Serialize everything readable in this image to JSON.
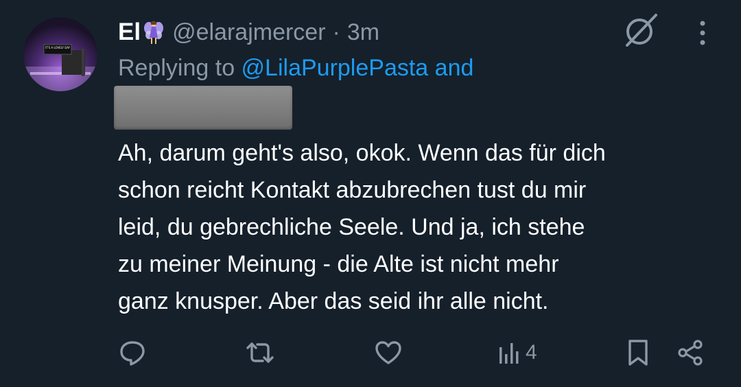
{
  "tweet": {
    "display_name": "El",
    "handle": "@elarajmercer",
    "separator": "·",
    "time": "3m",
    "replying_prefix": "Replying to ",
    "replying_mention": "@LilaPurplePasta",
    "replying_suffix": " and",
    "text_lines": [
      "Ah, darum geht's also, okok. Wenn das für dich",
      "schon reicht Kontakt abzubrechen tust du mir",
      "leid, du gebrechliche Seele. Und ja, ich stehe",
      "zu meiner Meinung - die Alte ist nicht mehr",
      "ganz knusper. Aber das seid ihr alle nicht."
    ],
    "avatar_sign_text": "IT'S A LOVELY DAY"
  },
  "actions": {
    "views_count": "4"
  },
  "icons": {
    "name_emoji": "fairy-icon",
    "top_right_1": "grok-icon",
    "top_right_2": "more-icon",
    "reply": "reply-icon",
    "retweet": "retweet-icon",
    "like": "like-icon",
    "views": "views-icon",
    "bookmark": "bookmark-icon",
    "share": "share-icon"
  },
  "colors": {
    "background": "#15202b",
    "text": "#ffffff",
    "secondary_text": "#8b98a5",
    "link": "#1d9bf0"
  }
}
